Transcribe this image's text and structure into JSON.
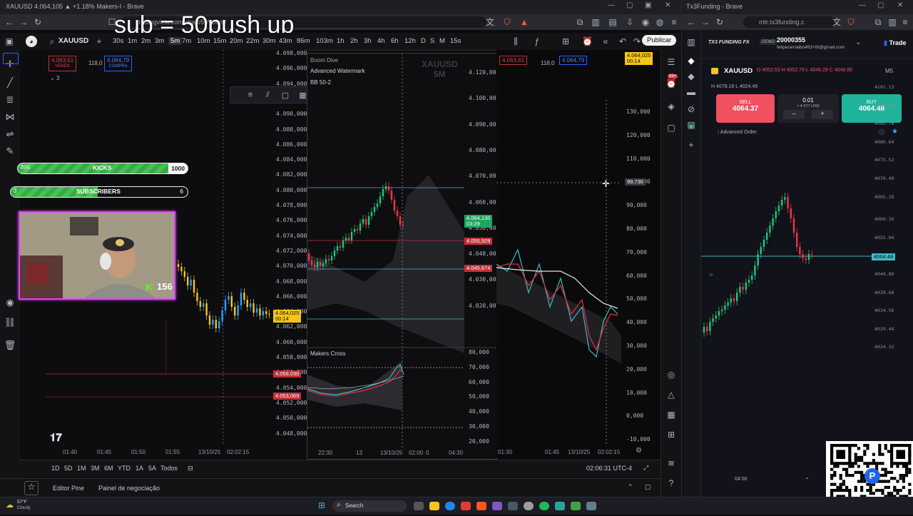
{
  "left_browser": {
    "tab_title": "XAUUSD 4.064,105 ▲ +1.18% Makers-I - Brave",
    "url": "tradingview.com/chart/50Vo0m/",
    "overlay_text": "sub = 50push up"
  },
  "right_browser": {
    "tab_title": "Tx3Funding - Brave",
    "url": "mtr.tx3funding.c"
  },
  "tv": {
    "symbol": "XAUUSD",
    "timeframes": [
      "30s",
      "1m",
      "2m",
      "3m",
      "5m",
      "7m",
      "10m",
      "15m",
      "20m",
      "22m",
      "30m",
      "43m",
      "86m",
      "103m",
      "1h",
      "2h",
      "3h",
      "4h",
      "6h",
      "12h",
      "D",
      "S",
      "M",
      "15s"
    ],
    "active_timeframe": "5m",
    "publish": "Publicar",
    "sell_price": "4.063,61",
    "sell_label": "VENDA",
    "spread": "118,0",
    "buy_price": "4.064,79",
    "buy_label": "COMPRA",
    "qty": "3",
    "left_price_axis": [
      "4.098,000",
      "4.096,000",
      "4.094,000",
      "4.092,000",
      "4.090,000",
      "4.088,000",
      "4.086,000",
      "4.084,000",
      "4.082,000",
      "4.080,000",
      "4.078,000",
      "4.076,000",
      "4.074,000",
      "4.072,000",
      "4.070,000",
      "4.068,000",
      "4.066,000",
      "4.064,000",
      "4.062,000",
      "4.060,000",
      "4.058,000",
      "4.056,000",
      "4.054,000",
      "4.052,000",
      "4.050,000",
      "4.048,000"
    ],
    "left_label_current": "4.064,025",
    "left_label_current_time": "00:14",
    "left_label_red1": "4.056,030",
    "left_label_red2": "4.053,069",
    "left_time_axis": [
      "01:40",
      "01:45",
      "01:50",
      "01:55",
      "13/10/25",
      "02:02:15"
    ],
    "mid_title": "Boom Dive",
    "mid_watermark1": "XAUUSD",
    "mid_watermark2": "5M",
    "mid_indicator1": "Advanced Watermark",
    "mid_indicator2": "BB 50-2",
    "mid_price_axis": [
      "4.120,000",
      "4.100,000",
      "4.090,000",
      "4.080,000",
      "4.070,000",
      "4.060,000",
      "4.050,000",
      "4.040,000",
      "4.030,000",
      "4.020,000"
    ],
    "mid_label_green": "4.064,130",
    "mid_label_green_time": "03:29",
    "mid_label_red1": "4.055,929",
    "mid_label_red2": "4.045,674",
    "mid_sub_title": "Makers Cross",
    "mid_sub_axis": [
      "80,000",
      "70,000",
      "60,000",
      "50,000",
      "40,000",
      "30,000",
      "20,000"
    ],
    "mid_time_axis": [
      "22:30",
      "13",
      "13/10/25",
      "02:00",
      "0",
      "04:30"
    ],
    "right_sell_price": "4.063,61",
    "right_spread": "118,0",
    "right_buy_price": "4.064,79",
    "right_top_label": "4.064,025",
    "right_top_label_time": "00:14",
    "right_axis": [
      "130,000",
      "120,000",
      "110,000",
      "100,000",
      "90,000",
      "80,000",
      "70,000",
      "60,000",
      "50,000",
      "40,000",
      "30,000",
      "20,000",
      "10,000",
      "0,000",
      "-10,000"
    ],
    "right_cursor_label": "99,730",
    "right_time_axis": [
      "01:30",
      "01:45",
      "13/10/25",
      "02:02:15"
    ],
    "bottom_ranges": [
      "1D",
      "5D",
      "1M",
      "3M",
      "6M",
      "YTD",
      "1A",
      "5A",
      "Todos"
    ],
    "clock": "02:06:31 UTC-4",
    "pine_editor": "Editor Pine",
    "trading_panel": "Painel de negociação",
    "notif_badge": "99+"
  },
  "stream": {
    "kicks_left": "895",
    "kicks_label": "KICKS",
    "kicks_goal": "1000",
    "subs_left": "3",
    "subs_label": "SUBSCRIBERS",
    "subs_goal": "6",
    "kick_count": "156",
    "kick_letter": "K"
  },
  "tx3": {
    "brand": "TX3 FUNDING FX",
    "account_type": "DEMO",
    "account_id": "20000355",
    "account_email": "felipeserraibo483+ttt@gmail.com",
    "trade_tab": "Trade",
    "symbol": "XAUUSD",
    "ohlc": "O 4052.53 H 4052.79 L 4046.29 C 4049.85",
    "ohlc2": "H 4078.18 L 4024.49",
    "timeframe": "M5",
    "sell_label": "SELL",
    "sell_price": "4064.37",
    "buy_label": "BUY",
    "buy_price": "4064.48",
    "lot": "0.01",
    "lot_usd": "≈ 4 077 USD",
    "advanced_order": "Advanced Order",
    "price_axis": [
      "4101.13",
      "4090.64",
      "4085.76",
      "4080.64",
      "4075.52",
      "4070.40",
      "4065.28",
      "4064.48",
      "4060.16",
      "4055.04",
      "4049.92",
      "4044.80",
      "4039.68",
      "4034.56",
      "4029.44",
      "4024.32"
    ],
    "time_label": "04:00"
  },
  "taskbar": {
    "weather_temp": "57°F",
    "weather_desc": "Cloudy",
    "search": "Search"
  }
}
